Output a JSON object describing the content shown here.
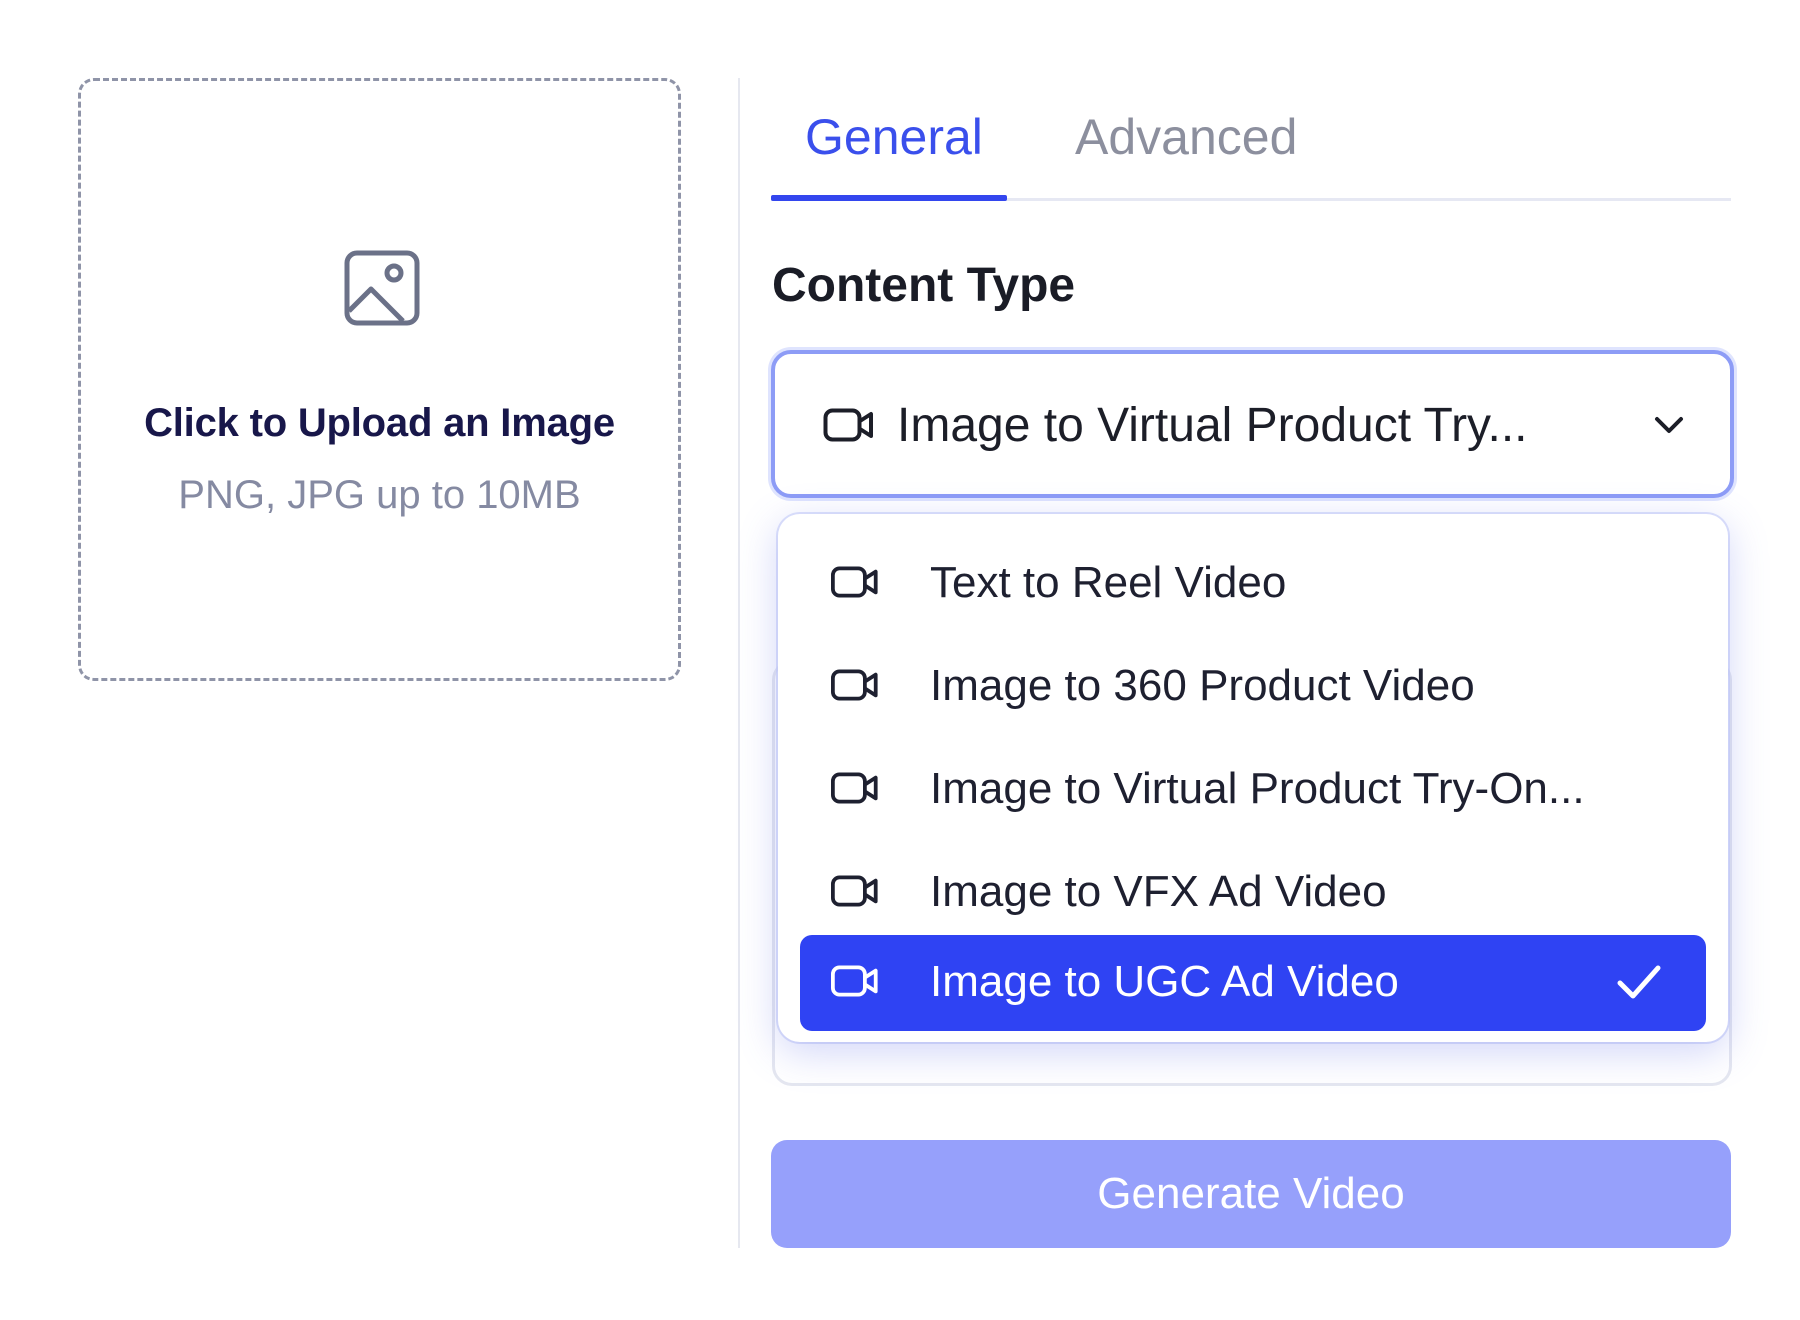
{
  "upload": {
    "title": "Click to Upload an Image",
    "subtitle": "PNG, JPG up to 10MB",
    "icon": "image-icon"
  },
  "tabs": [
    {
      "label": "General",
      "active": true
    },
    {
      "label": "Advanced",
      "active": false
    }
  ],
  "content_type": {
    "label": "Content Type",
    "selected_value": "Image to Virtual Product Try...",
    "icon": "video-camera-icon",
    "options": [
      {
        "label": "Text to Reel Video",
        "selected": false
      },
      {
        "label": "Image to 360 Product Video",
        "selected": false
      },
      {
        "label": "Image to Virtual Product Try-On...",
        "selected": false
      },
      {
        "label": "Image to VFX Ad Video",
        "selected": false
      },
      {
        "label": "Image to UGC Ad Video",
        "selected": true
      }
    ]
  },
  "actions": {
    "generate_label": "Generate Video"
  },
  "colors": {
    "accent": "#3346ee",
    "selected_option_bg": "#2f43f3",
    "generate_button_bg": "#96a0fb",
    "inactive_tab": "#8c8f9e"
  }
}
